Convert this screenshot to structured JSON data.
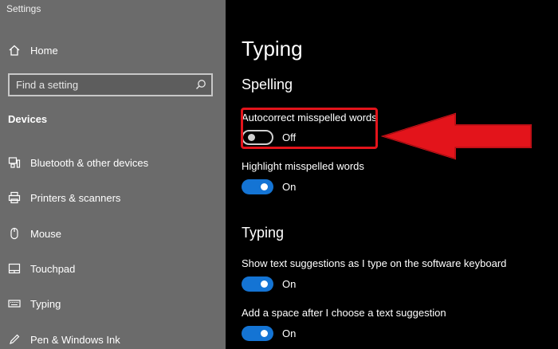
{
  "window": {
    "title": "Settings"
  },
  "sidebar": {
    "home_label": "Home",
    "search_placeholder": "Find a setting",
    "section_title": "Devices",
    "items": [
      {
        "label": "Bluetooth & other devices",
        "icon": "bluetooth-devices-icon"
      },
      {
        "label": "Printers & scanners",
        "icon": "printer-icon"
      },
      {
        "label": "Mouse",
        "icon": "mouse-icon"
      },
      {
        "label": "Touchpad",
        "icon": "touchpad-icon"
      },
      {
        "label": "Typing",
        "icon": "keyboard-icon"
      },
      {
        "label": "Pen & Windows Ink",
        "icon": "pen-icon"
      }
    ]
  },
  "main": {
    "page_title": "Typing",
    "spelling": {
      "title": "Spelling",
      "settings": [
        {
          "label": "Autocorrect misspelled words",
          "state": "Off"
        },
        {
          "label": "Highlight misspelled words",
          "state": "On"
        }
      ]
    },
    "typing": {
      "title": "Typing",
      "settings": [
        {
          "label": "Show text suggestions as I type on the software keyboard",
          "state": "On"
        },
        {
          "label": "Add a space after I choose a text suggestion",
          "state": "On"
        }
      ]
    }
  },
  "colors": {
    "sidebar_bg": "#6b6b6b",
    "main_bg": "#000000",
    "toggle_on": "#1474d4",
    "annotation_red": "#e3141b"
  }
}
